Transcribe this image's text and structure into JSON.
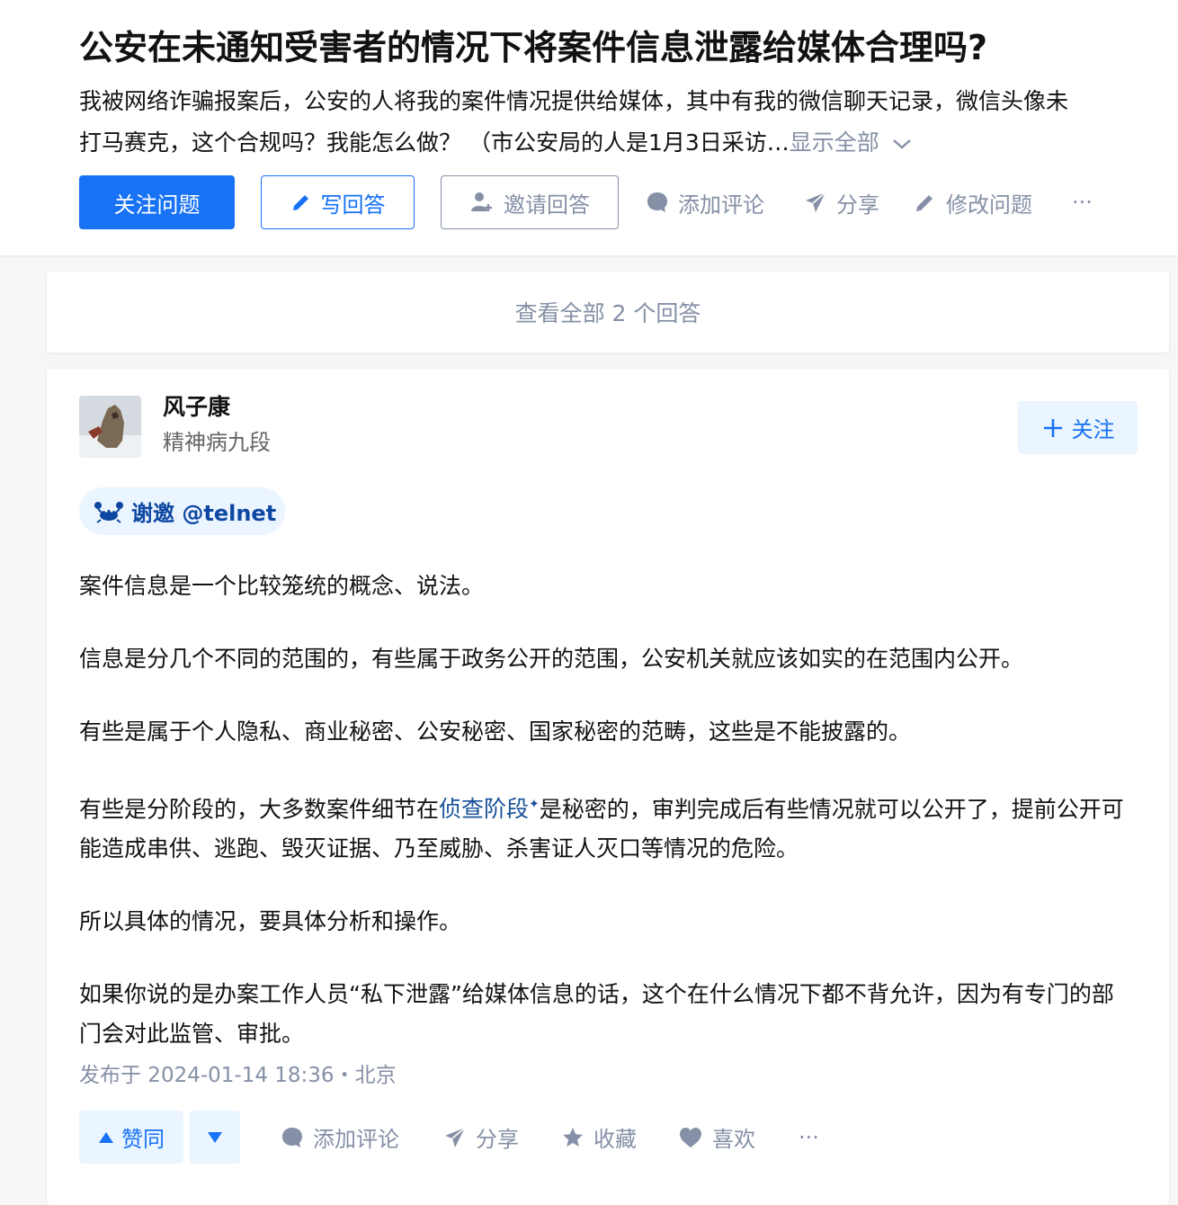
{
  "question": {
    "title": "公安在未通知受害者的情况下将案件信息泄露给媒体合理吗?",
    "description_line1": "我被网络诈骗报案后，公安的人将我的案件情况提供给媒体，其中有我的微信聊天记录，微信头像未",
    "description_line2": "打马赛克，这个合规吗？我能怎么做？ （市公安局的人是1月3日采访…",
    "show_all": "显示全部",
    "actions": {
      "follow": "关注问题",
      "write": "写回答",
      "invite": "邀请回答",
      "comment": "添加评论",
      "share": "分享",
      "edit": "修改问题",
      "more": "···"
    }
  },
  "view_all": "查看全部 2 个回答",
  "answer": {
    "author_name": "风子康",
    "author_bio": "精神病九段",
    "follow_label": "关注",
    "invite_text": "谢邀 @telnet",
    "paragraphs": {
      "p1": "案件信息是一个比较笼统的概念、说法。",
      "p2": "信息是分几个不同的范围的，有些属于政务公开的范围，公安机关就应该如实的在范围内公开。",
      "p3": "有些是属于个人隐私、商业秘密、公安秘密、国家秘密的范畴，这些是不能披露的。",
      "p4_before": "有些是分阶段的，大多数案件细节在",
      "p4_keyword": "侦查阶段",
      "p4_after": "是秘密的，审判完成后有些情况就可以公开了，提前公开可能造成串供、逃跑、毁灭证据、乃至威胁、杀害证人灭口等情况的危险。",
      "p5": "所以具体的情况，要具体分析和操作。",
      "p6": "如果你说的是办案工作人员“私下泄露”给媒体信息的话，这个在什么情况下都不背允许，因为有专门的部门会对此监管、审批。"
    },
    "meta": "发布于 2024-01-14 18:36・北京",
    "actions": {
      "upvote": "赞同",
      "comment": "添加评论",
      "share": "分享",
      "collect": "收藏",
      "like": "喜欢",
      "more": "···"
    }
  },
  "colors": {
    "primary": "#1772f6",
    "muted": "#8590a6",
    "keyword": "#175199",
    "pill_bg": "#ebf5ff"
  }
}
